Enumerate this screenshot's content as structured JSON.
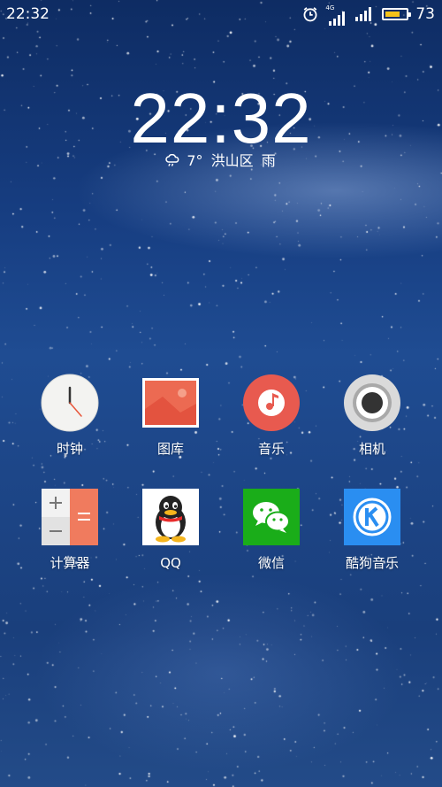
{
  "status_bar": {
    "time": "22:32",
    "network": "4G",
    "battery_level_percent": 73,
    "battery_text": "73",
    "icons": [
      "alarm-icon",
      "signal-4g-icon",
      "signal-icon",
      "battery-icon"
    ]
  },
  "lock_clock": {
    "time": "22:32",
    "temperature": "7°",
    "location": "洪山区",
    "condition": "雨",
    "weather_icon": "rain-cloud-icon"
  },
  "apps": [
    {
      "label": "时钟",
      "icon": "clock-icon"
    },
    {
      "label": "图库",
      "icon": "gallery-icon"
    },
    {
      "label": "音乐",
      "icon": "music-icon"
    },
    {
      "label": "相机",
      "icon": "camera-icon"
    },
    {
      "label": "计算器",
      "icon": "calculator-icon"
    },
    {
      "label": "QQ",
      "icon": "qq-icon"
    },
    {
      "label": "微信",
      "icon": "wechat-icon"
    },
    {
      "label": "酷狗音乐",
      "icon": "kugou-icon"
    }
  ],
  "colors": {
    "battery_fill": "#f4c21a",
    "music_red": "#e85a4f",
    "wechat_green": "#1aad19",
    "kugou_blue": "#2a8ef1",
    "calculator_orange": "#f07b5e"
  }
}
